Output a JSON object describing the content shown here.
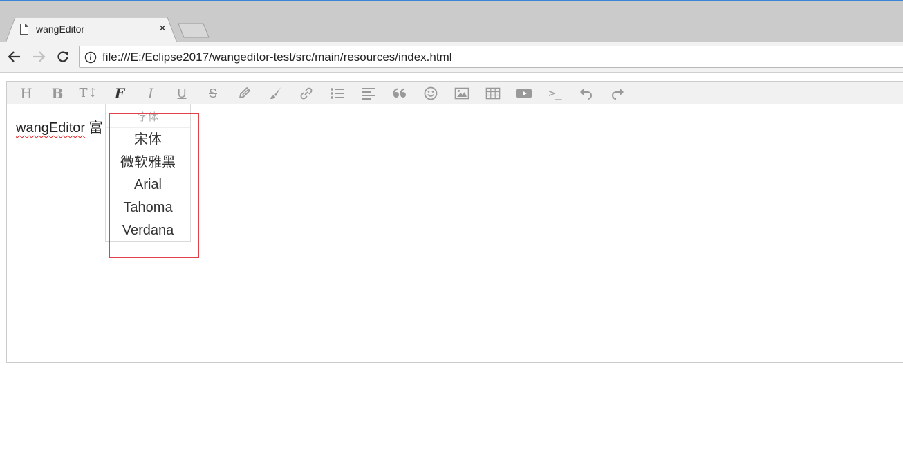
{
  "browser": {
    "tab": {
      "title": "wangEditor",
      "close_label": "×"
    },
    "address": {
      "url": "file:///E:/Eclipse2017/wangeditor-test/src/main/resources/index.html"
    }
  },
  "editor": {
    "toolbar": {
      "items": [
        {
          "name": "heading",
          "label": "H"
        },
        {
          "name": "bold",
          "label": "B"
        },
        {
          "name": "font-size",
          "label": "T↕"
        },
        {
          "name": "font-name",
          "label": "F"
        },
        {
          "name": "italic",
          "label": "I"
        },
        {
          "name": "underline",
          "label": "U"
        },
        {
          "name": "strikethrough",
          "label": "S"
        },
        {
          "name": "fore-color",
          "label": ""
        },
        {
          "name": "back-color",
          "label": ""
        },
        {
          "name": "link",
          "label": ""
        },
        {
          "name": "list",
          "label": ""
        },
        {
          "name": "justify",
          "label": ""
        },
        {
          "name": "quote",
          "label": "66"
        },
        {
          "name": "emoticon",
          "label": ""
        },
        {
          "name": "image",
          "label": ""
        },
        {
          "name": "table",
          "label": ""
        },
        {
          "name": "video",
          "label": ""
        },
        {
          "name": "code",
          "label": ">_"
        },
        {
          "name": "undo",
          "label": ""
        },
        {
          "name": "redo",
          "label": ""
        }
      ]
    },
    "content": {
      "word": "wangEditor",
      "rest": " 富"
    },
    "font_dropdown": {
      "title": "字体",
      "options": [
        "宋体",
        "微软雅黑",
        "Arial",
        "Tahoma",
        "Verdana"
      ]
    }
  },
  "colors": {
    "accent": "#3c84d6",
    "highlight": "#e0424b",
    "icon": "#999999"
  }
}
